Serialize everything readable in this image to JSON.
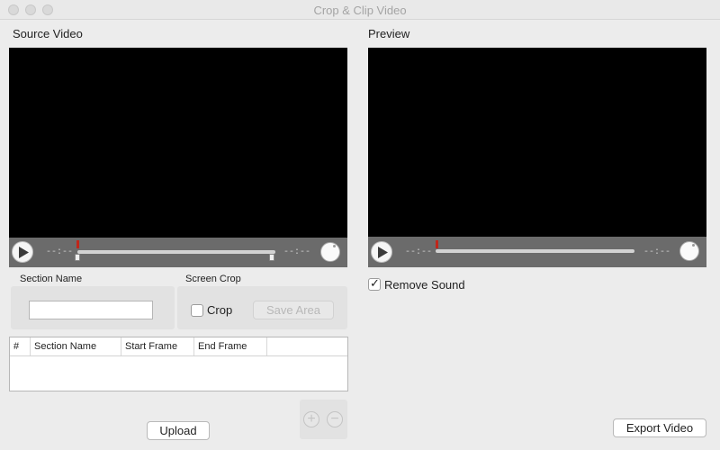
{
  "window": {
    "title": "Crop & Clip Video"
  },
  "source": {
    "label": "Source Video",
    "time_start": "--:--",
    "time_end": "--:--"
  },
  "preview": {
    "label": "Preview",
    "time_start": "--:--",
    "time_end": "--:--",
    "remove_sound_label": "Remove Sound",
    "remove_sound_checked": true
  },
  "section_name": {
    "title": "Section Name",
    "value": ""
  },
  "screen_crop": {
    "title": "Screen Crop",
    "crop_label": "Crop",
    "crop_checked": false,
    "save_area_label": "Save Area"
  },
  "table": {
    "columns": [
      "#",
      "Section Name",
      "Start Frame",
      "End Frame",
      ""
    ],
    "rows": []
  },
  "buttons": {
    "upload": "Upload",
    "export": "Export Video",
    "add": "+",
    "remove": "−"
  },
  "icons": {
    "play": "play-icon",
    "volume": "volume-knob-icon",
    "check": "checkmark-icon"
  }
}
